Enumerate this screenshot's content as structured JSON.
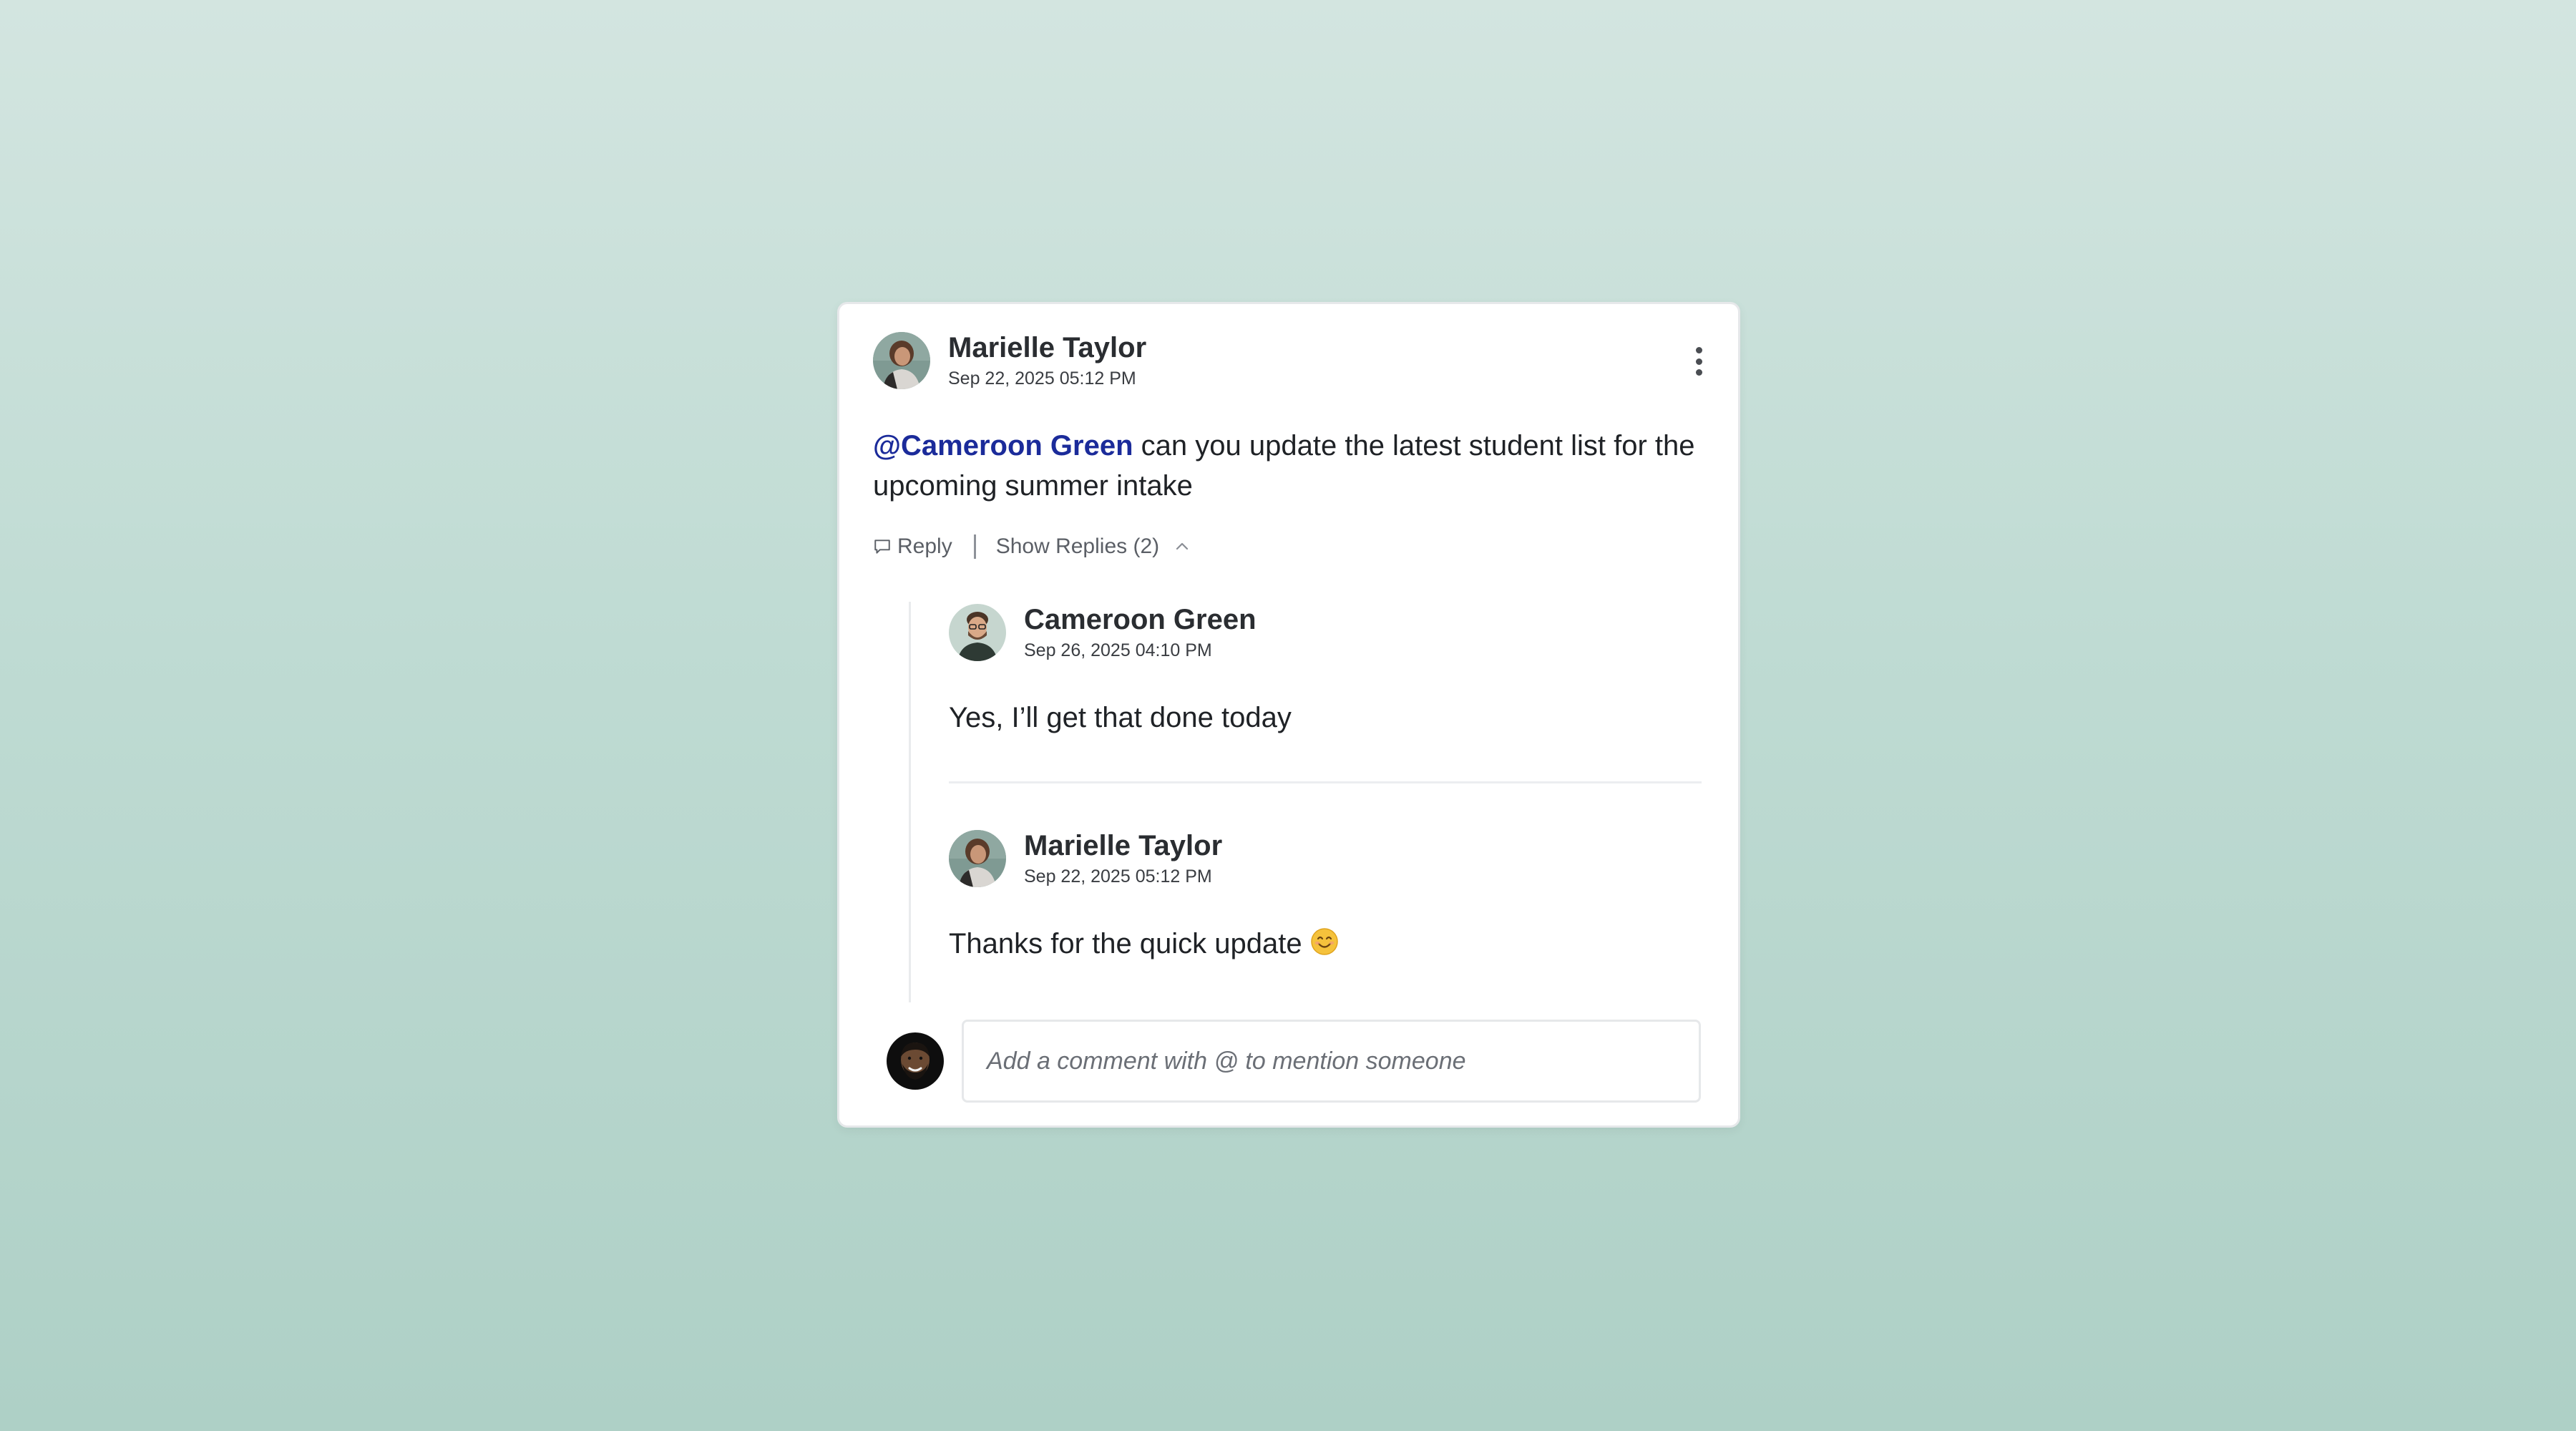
{
  "comment": {
    "author": "Marielle Taylor",
    "timestamp": "Sep 22, 2025 05:12 PM",
    "mention": "@Cameroon Green",
    "text": " can you update the latest student list for the upcoming summer intake",
    "more_icon": "kebab-menu-icon"
  },
  "actions": {
    "reply_label": "Reply",
    "reply_icon": "comment-bubble-icon",
    "show_replies_label": "Show Replies (2)",
    "toggle_icon": "chevron-up-icon"
  },
  "replies": [
    {
      "author": "Cameroon Green",
      "timestamp": "Sep 26, 2025 04:10 PM",
      "text": "Yes, I’ll get that done today"
    },
    {
      "author": "Marielle Taylor",
      "timestamp": "Sep 22, 2025 05:12 PM",
      "text": "Thanks for the quick update ",
      "emoji_icon": "smiling-face-emoji-icon"
    }
  ],
  "composer": {
    "placeholder": "Add a comment with @ to mention someone"
  },
  "colors": {
    "mention": "#1b2b9a",
    "background_top": "#d3e5e0",
    "background_bottom": "#aed0c6",
    "card": "#ffffff"
  }
}
